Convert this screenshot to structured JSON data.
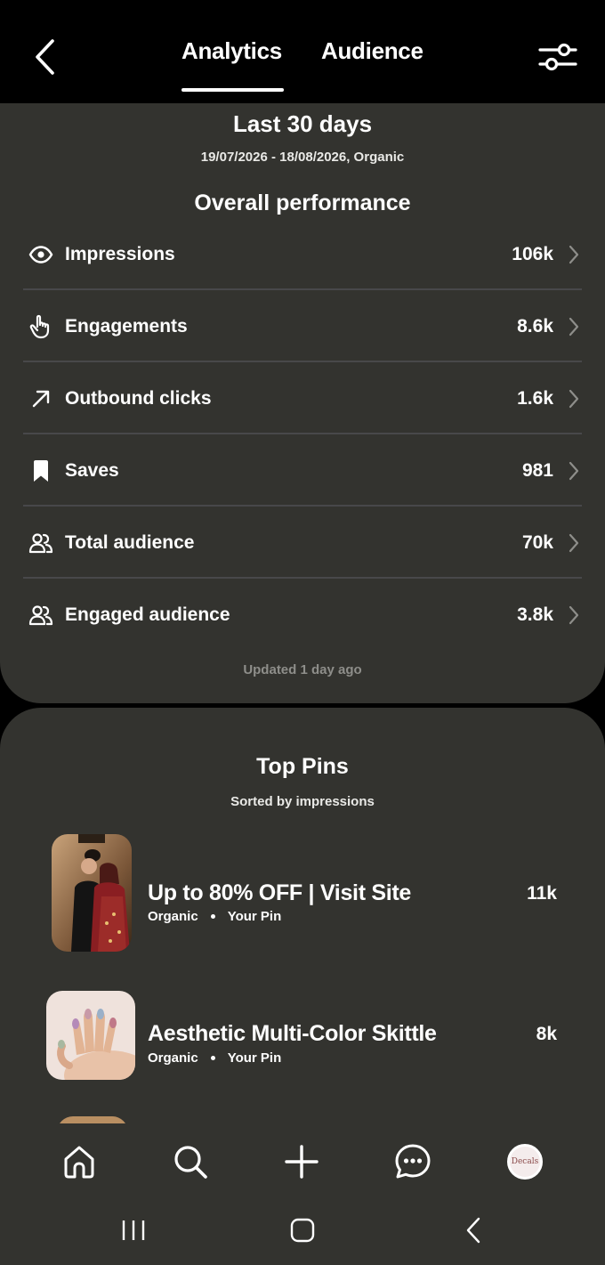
{
  "header": {
    "tabs": [
      {
        "label": "Analytics",
        "active": true
      },
      {
        "label": "Audience",
        "active": false
      }
    ],
    "back_icon": "chevron-left-icon",
    "filter_icon": "sliders-icon"
  },
  "overview": {
    "range_title": "Last 30 days",
    "range_subtitle": "19/07/2026 - 18/08/2026, Organic",
    "section_title": "Overall performance",
    "metrics": [
      {
        "label": "Impressions",
        "value": "106k",
        "icon": "eye-icon"
      },
      {
        "label": "Engagements",
        "value": "8.6k",
        "icon": "hand-pointer-icon"
      },
      {
        "label": "Outbound clicks",
        "value": "1.6k",
        "icon": "arrow-up-right-icon"
      },
      {
        "label": "Saves",
        "value": "981",
        "icon": "bookmark-icon"
      },
      {
        "label": "Total audience",
        "value": "70k",
        "icon": "users-icon"
      },
      {
        "label": "Engaged audience",
        "value": "3.8k",
        "icon": "users-icon"
      }
    ],
    "updated": "Updated 1 day ago"
  },
  "top_pins": {
    "title": "Top Pins",
    "subtitle": "Sorted by impressions",
    "pins": [
      {
        "title": "Up to 80% OFF | Visit Site",
        "source": "Organic",
        "owner": "Your Pin",
        "value": "11k"
      },
      {
        "title": "Aesthetic Multi-Color Skittle",
        "source": "Organic",
        "owner": "Your Pin",
        "value": "8k"
      }
    ]
  },
  "bottom_nav": {
    "items": [
      "home-icon",
      "search-icon",
      "plus-icon",
      "messages-icon",
      "profile-avatar"
    ],
    "avatar_text": "Decals"
  },
  "system_nav": [
    "recents-icon",
    "home-button-icon",
    "back-icon"
  ],
  "colors": {
    "background": "#000000",
    "card": "#33332f",
    "divider": "#48484a",
    "muted_text": "#8e8e8a"
  }
}
